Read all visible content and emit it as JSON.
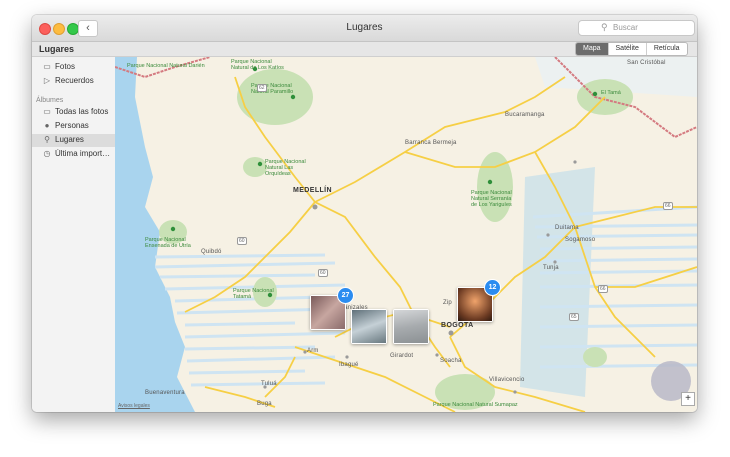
{
  "window": {
    "title": "Lugares"
  },
  "search": {
    "placeholder": "Buscar"
  },
  "toolbar": {
    "title": "Lugares",
    "segments": [
      "Mapa",
      "Satélite",
      "Retícula"
    ],
    "active_segment": "Mapa"
  },
  "sidebar": {
    "items": [
      {
        "label": "Fotos",
        "icon": "photos-icon"
      },
      {
        "label": "Recuerdos",
        "icon": "memories-icon"
      }
    ],
    "section_label": "Álbumes",
    "albums": [
      {
        "label": "Todas las fotos",
        "icon": "all-photos-icon"
      },
      {
        "label": "Personas",
        "icon": "person-icon"
      },
      {
        "label": "Lugares",
        "icon": "pin-icon",
        "selected": true
      },
      {
        "label": "Última import…",
        "icon": "clock-icon"
      }
    ]
  },
  "map": {
    "cities": {
      "medellin": "MEDELLÍN",
      "bogota": "BOGOTA"
    },
    "places": {
      "san_cristobal": "San Cristóbal",
      "barranca": "Barranca Bermeja",
      "bucaramanga": "Bucaramanga",
      "quibdo": "Quibdó",
      "manizales": "Manizales",
      "zipaquira": "Zip",
      "armenia": "Arm",
      "ibague": "Ibagué",
      "girardot": "Girardot",
      "soacha": "Soacha",
      "tunja": "Tunja",
      "sogamoso": "Sogamoso",
      "duitama": "Duitama",
      "villavicencio": "Villavicencio",
      "tulua": "Tuluá",
      "buenaventura": "Buenaventura",
      "buga": "Buga"
    },
    "parks": {
      "darien": "Parque Nacional\nNatural Darién",
      "katios": "Parque Nacional\nNatural de Los Katíos",
      "paramillo": "Parque Nacional\nNatural Paramillo",
      "tama": "El Tamá",
      "orquideas": "Parque Nacional\nNatural Las\nOrquídeas",
      "utria": "Parque Nacional\nEnsenada de Utría",
      "yariguies": "Parque Nacional\nNatural Serranía\nde Los Yariguíes",
      "tatama": "Parque Nacional\nTatamá",
      "sumapaz": "Parque Nacional Natural Sumapaz"
    },
    "routes": [
      "62",
      "62",
      "60",
      "60",
      "66",
      "66",
      "66",
      "65"
    ],
    "clusters": [
      {
        "count": "27"
      },
      {
        "count": "12"
      }
    ],
    "legal": "Avisos legales",
    "zoom_symbol": "+"
  },
  "colors": {
    "land": "#f6f1e4",
    "water": "#a9d4ee",
    "road": "#f6cf45",
    "park": "#c9e1b5",
    "border": "#d47a80",
    "accent": "#2b8cf0"
  }
}
